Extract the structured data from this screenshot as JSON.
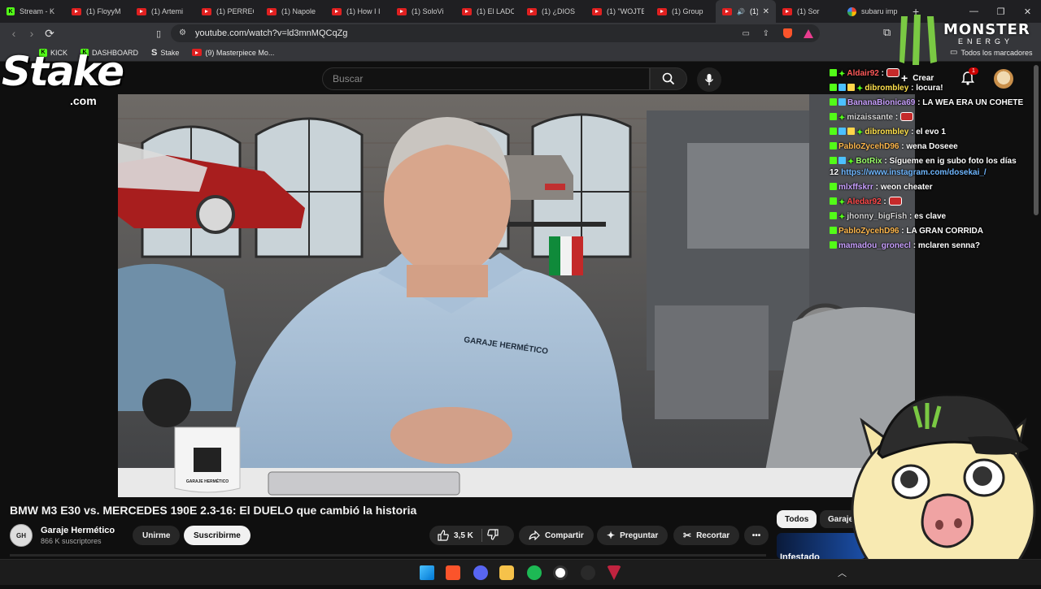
{
  "tabs": [
    {
      "label": "Stream - K",
      "icon": "kick"
    },
    {
      "label": "(1) FloyyM",
      "icon": "yt"
    },
    {
      "label": "(1) Artemi",
      "icon": "yt"
    },
    {
      "label": "(1) PERREO",
      "icon": "yt"
    },
    {
      "label": "(1) Napole",
      "icon": "yt"
    },
    {
      "label": "(1) How I I",
      "icon": "yt"
    },
    {
      "label": "(1) SoloVi",
      "icon": "yt"
    },
    {
      "label": "(1) El LADO",
      "icon": "yt"
    },
    {
      "label": "(1) ¿DIOS",
      "icon": "yt"
    },
    {
      "label": "(1) \"WOJTE",
      "icon": "yt"
    },
    {
      "label": "(1) Group",
      "icon": "yt"
    },
    {
      "label": "(1)",
      "icon": "yt",
      "active": true
    },
    {
      "label": "(1) Sor",
      "icon": "yt"
    },
    {
      "label": "subaru imp",
      "icon": "google"
    }
  ],
  "address": {
    "url": "youtube.com/watch?v=ld3mnMQCqZg"
  },
  "bookmarks": [
    {
      "label": "KICK"
    },
    {
      "label": "DASHBOARD"
    },
    {
      "label": "Stake"
    },
    {
      "label": "(9) Masterpiece Mo..."
    }
  ],
  "bookmarks_all": "Todos los marcadores",
  "yt": {
    "search_placeholder": "Buscar",
    "create_label": "Crear",
    "notif_count": "1",
    "video_title": "BMW M3 E30 vs. MERCEDES 190E 2.3-16: El DUELO que cambió la historia",
    "channel_name": "Garaje Hermético",
    "subscribers": "866 K suscriptores",
    "join": "Unirme",
    "subscribe": "Suscribirme",
    "likes": "3,5 K",
    "share": "Compartir",
    "ask": "Preguntar",
    "clip": "Recortar",
    "filters": [
      "Todos",
      "Garaje He"
    ],
    "rec_thumb_text": "Infestado"
  },
  "overlay": {
    "stake_brand": "Stake",
    "stake_sub": ".com",
    "monster_brand": "MONSTER",
    "monster_sub": "ENERGY",
    "mug_text": "GARAJE HERMÉTICO",
    "shirt_text": "GARAJE HERMÉTICO"
  },
  "chat": [
    {
      "user": "Aldair92",
      "text": "",
      "color": "#ff5a5a",
      "badges": [
        "k",
        "star"
      ],
      "emote": true
    },
    {
      "user": "dibrombley",
      "text": "locura!",
      "color": "#ffe14d",
      "badges": [
        "k",
        "s",
        "g",
        "star"
      ]
    },
    {
      "user": "BananaBionica69",
      "text": "LA WEA ERA UN COHETE",
      "color": "#c9a0ff",
      "badges": [
        "k",
        "s"
      ]
    },
    {
      "user": "mizaissante",
      "text": "",
      "color": "#d6d6d6",
      "badges": [
        "k",
        "star"
      ],
      "emote": true
    },
    {
      "user": "dibrombley",
      "text": "el evo 1",
      "color": "#ffe14d",
      "badges": [
        "k",
        "s",
        "g",
        "star"
      ]
    },
    {
      "user": "PabloZycehD96",
      "text": "wena Doseee",
      "color": "#ffb84d",
      "badges": [
        "k"
      ]
    },
    {
      "user": "BotRix",
      "text": "Sígueme en ig subo foto los días 12",
      "link": "https://www.instagram.com/dosekai_/",
      "color": "#9bff6a",
      "badges": [
        "k",
        "s",
        "star"
      ]
    },
    {
      "user": "mlxffskrr",
      "text": "weon cheater",
      "color": "#c9a0ff",
      "badges": [
        "k"
      ]
    },
    {
      "user": "Aledar92",
      "text": "",
      "color": "#ff4a4a",
      "badges": [
        "k",
        "star"
      ],
      "emote": true
    },
    {
      "user": "jhonny_bigFish",
      "text": "es clave",
      "color": "#d6d6d6",
      "badges": [
        "k",
        "star"
      ]
    },
    {
      "user": "PabloZycehD96",
      "text": "LA GRAN CORRIDA",
      "color": "#ffb84d",
      "badges": [
        "k"
      ]
    },
    {
      "user": "mamadou_gronecl",
      "text": "mclaren senna?",
      "color": "#c9a0ff",
      "badges": [
        "k"
      ]
    }
  ]
}
